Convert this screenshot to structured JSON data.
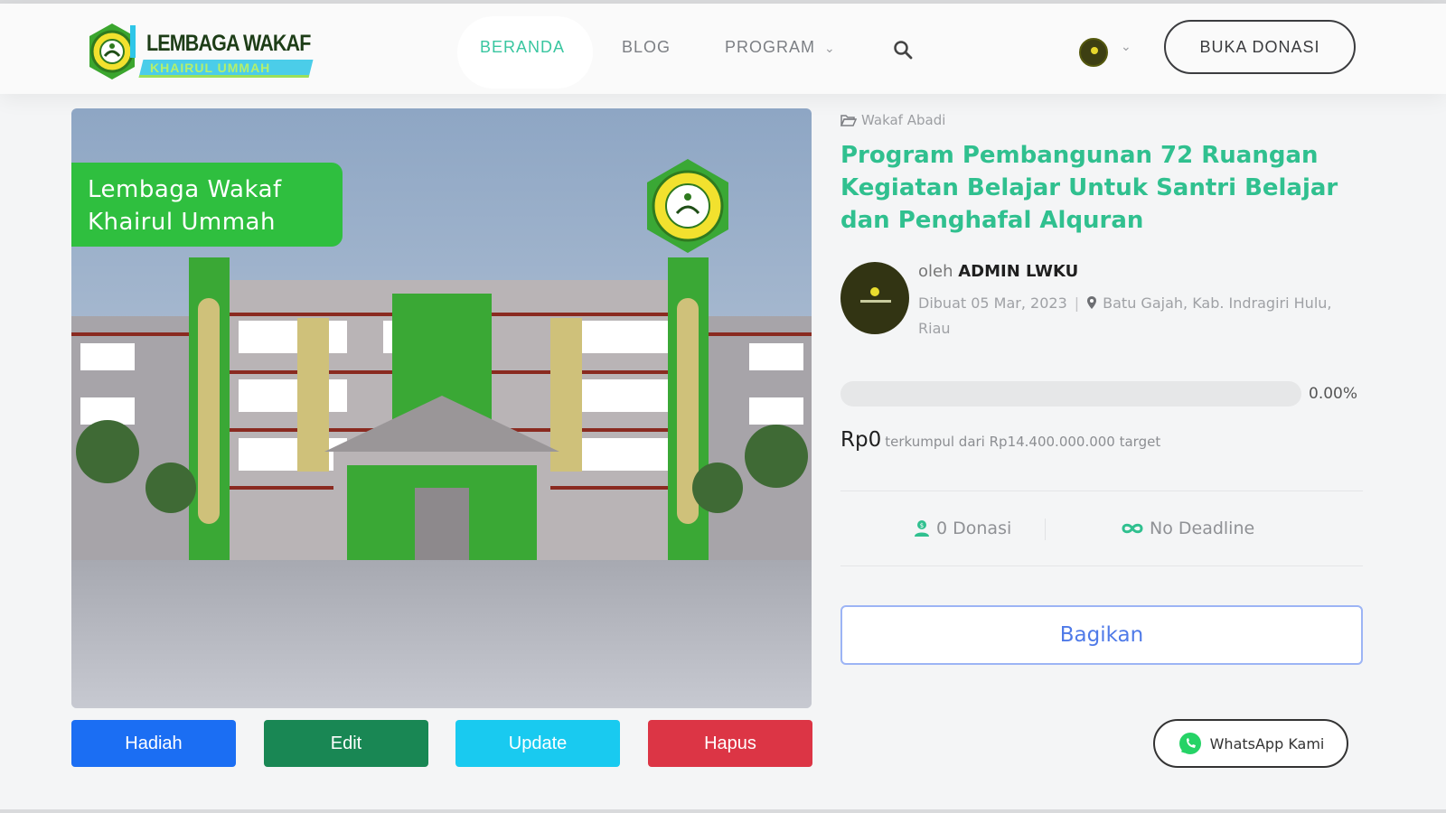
{
  "logo": {
    "line1": "LEMBAGA WAKAF",
    "line2": "KHAIRUL UMMAH"
  },
  "nav": {
    "items": [
      {
        "label": "BERANDA",
        "active": true
      },
      {
        "label": "BLOG",
        "active": false
      },
      {
        "label": "PROGRAM",
        "active": false,
        "has_dropdown": true
      }
    ],
    "search_icon": "search-icon",
    "account_icon": "avatar",
    "cta_label": "BUKA DONASI"
  },
  "hero": {
    "caption_line1": "Lembaga Wakaf",
    "caption_line2": "Khairul Ummah"
  },
  "actions": {
    "hadiah": "Hadiah",
    "edit": "Edit",
    "update": "Update",
    "hapus": "Hapus"
  },
  "campaign": {
    "category": "Wakaf Abadi",
    "title": "Program Pembangunan 72 Ruangan Kegiatan Belajar Untuk Santri Belajar dan Penghafal Alquran",
    "by_prefix": "oleh",
    "author": "ADMIN LWKU",
    "created": "Dibuat 05 Mar, 2023",
    "location": "Batu Gajah, Kab. Indragiri Hulu, Riau",
    "progress_fraction": 0,
    "progress_label": "0.00%",
    "collected": "Rp0",
    "collected_suffix": "terkumpul dari Rp14.400.000.000 target",
    "donations": "0 Donasi",
    "deadline": "No Deadline",
    "share_label": "Bagikan"
  },
  "whatsapp_label": "WhatsApp Kami",
  "colors": {
    "accent": "#30c08f",
    "hadiah": "#1b6ef3",
    "edit": "#198754",
    "update": "#19caf0",
    "hapus": "#dc3545",
    "share_text": "#4f7ae8",
    "whatsapp": "#25d366"
  }
}
